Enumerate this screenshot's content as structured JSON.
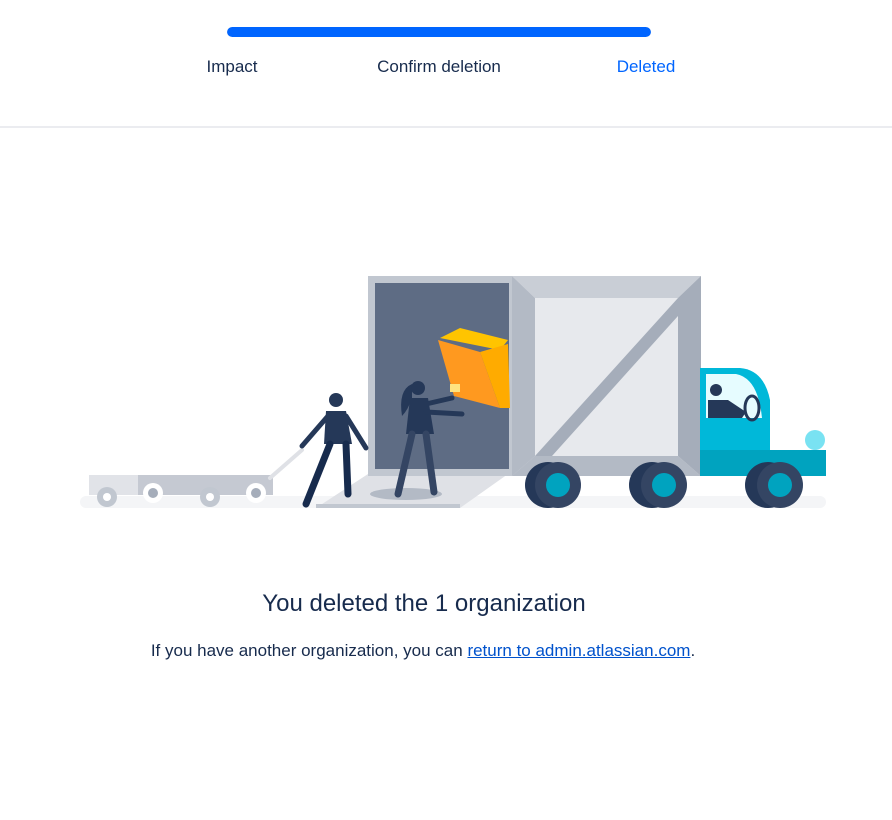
{
  "progress": {
    "percent": 100,
    "steps": [
      {
        "label": "Impact",
        "state": "done"
      },
      {
        "label": "Confirm deletion",
        "state": "done"
      },
      {
        "label": "Deleted",
        "state": "current"
      }
    ]
  },
  "main": {
    "title": "You deleted the 1 organization",
    "message_prefix": "If you have another organization, you can ",
    "link_text": "return to admin.atlassian.com",
    "message_suffix": "."
  },
  "colors": {
    "accent": "#0065ff",
    "text": "#172b4d",
    "link": "#0052cc",
    "divider": "#ebecf0"
  }
}
